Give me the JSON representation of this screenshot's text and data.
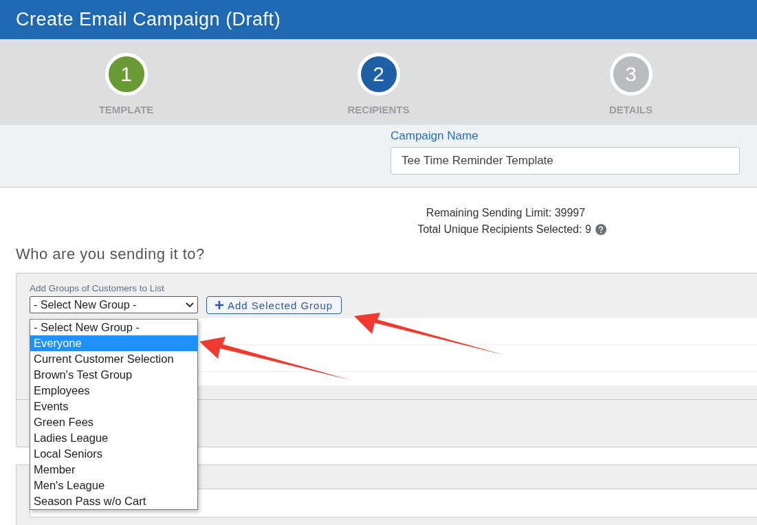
{
  "header": {
    "title": "Create Email Campaign (Draft)"
  },
  "steps": [
    {
      "number": "1",
      "label": "TEMPLATE",
      "color": "#6a9a35"
    },
    {
      "number": "2",
      "label": "RECIPIENTS",
      "color": "#1f5fa5"
    },
    {
      "number": "3",
      "label": "DETAILS",
      "color": "#b9bcc0"
    }
  ],
  "campaign_name": {
    "label": "Campaign Name",
    "value": "Tee Time Reminder Template"
  },
  "summary": {
    "remaining_limit": "Remaining Sending Limit: 39997",
    "total_recipients": "Total Unique Recipients Selected: 9"
  },
  "section_title": "Who are you sending it to?",
  "groups_panel": {
    "label": "Add Groups of Customers to List",
    "select_value": "- Select New Group -",
    "add_button": "Add Selected Group",
    "options": [
      {
        "label": "- Select New Group -",
        "selected": false
      },
      {
        "label": "Everyone",
        "selected": true
      },
      {
        "label": "Current Customer Selection",
        "selected": false
      },
      {
        "label": "Brown's Test Group",
        "selected": false
      },
      {
        "label": "Employees",
        "selected": false
      },
      {
        "label": "Events",
        "selected": false
      },
      {
        "label": "Green Fees",
        "selected": false
      },
      {
        "label": "Ladies League",
        "selected": false
      },
      {
        "label": "Local Seniors",
        "selected": false
      },
      {
        "label": "Member",
        "selected": false
      },
      {
        "label": "Men's League",
        "selected": false
      },
      {
        "label": "Season Pass w/o Cart",
        "selected": false
      }
    ]
  }
}
